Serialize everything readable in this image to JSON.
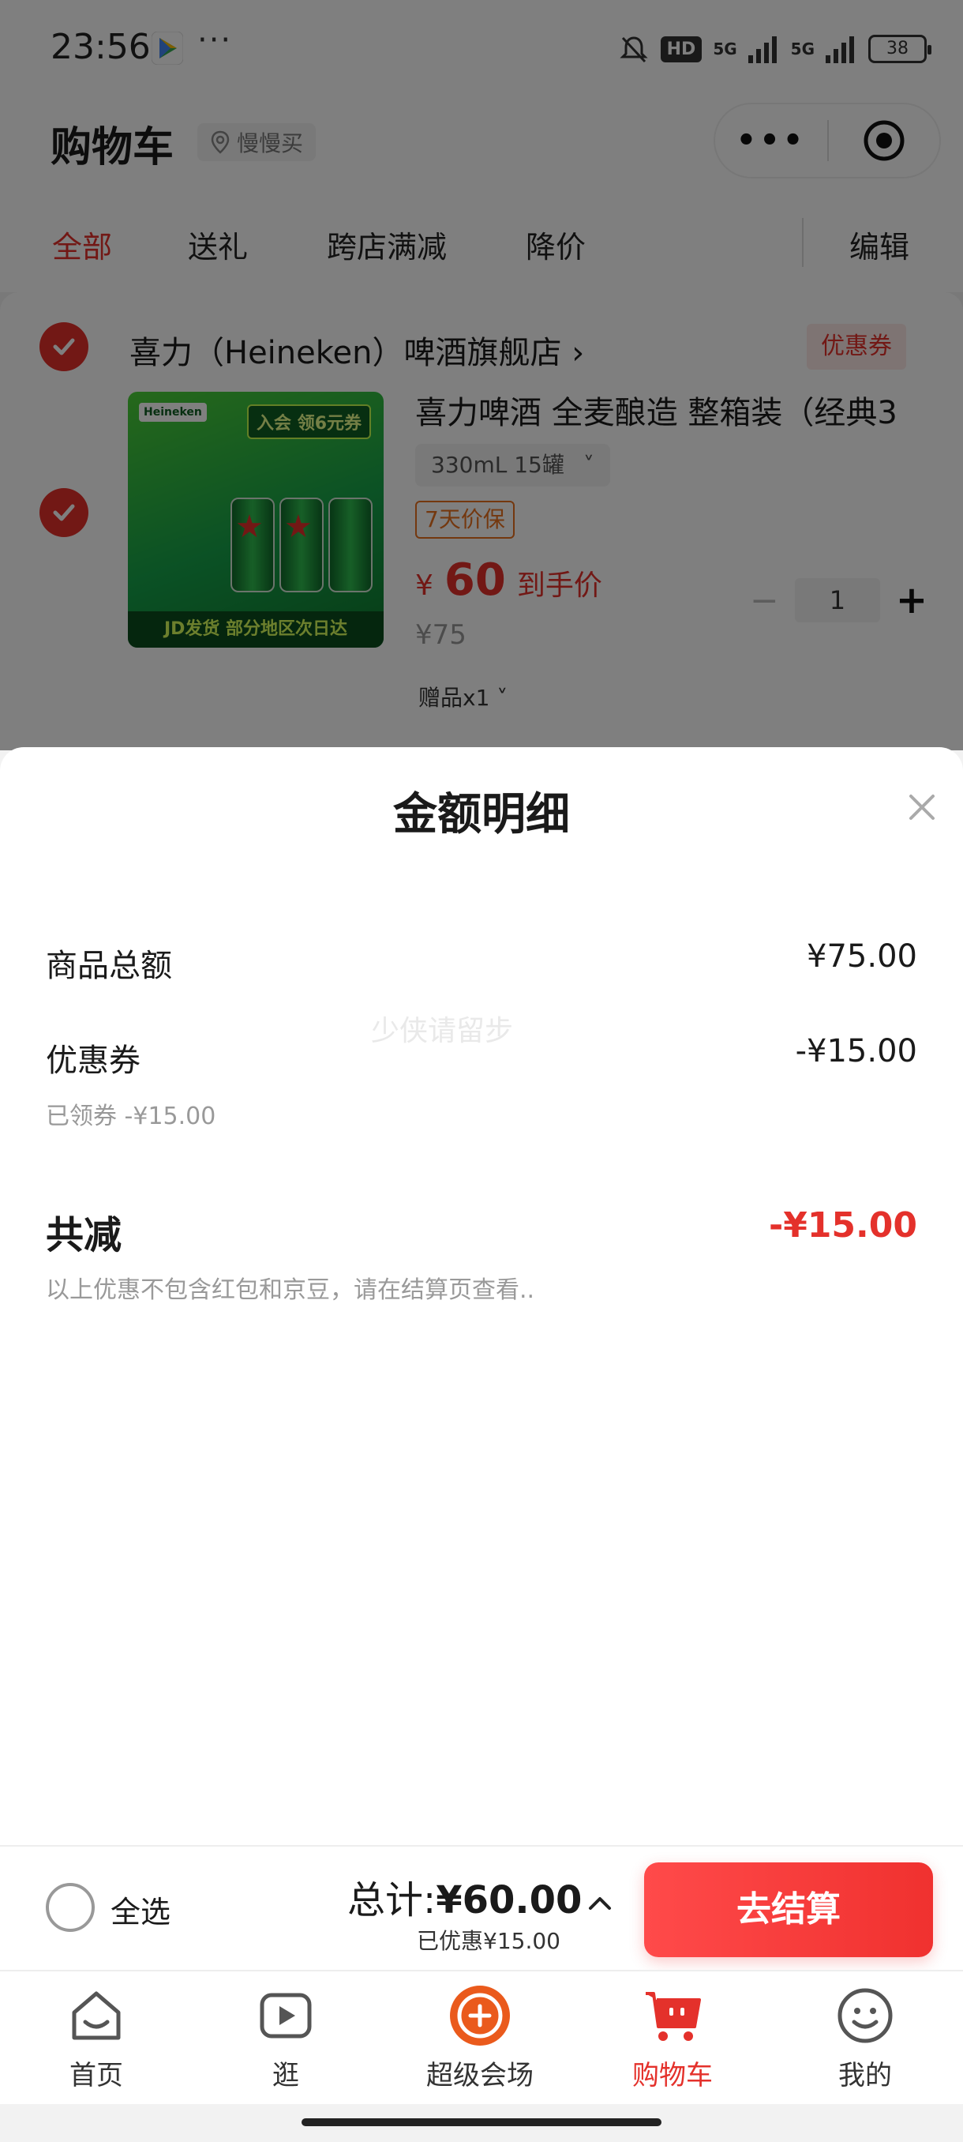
{
  "status_bar": {
    "time": "23:56",
    "dots": "···",
    "hd": "HD",
    "net1": "5G",
    "net2": "5G",
    "battery": "38"
  },
  "header": {
    "title": "购物车",
    "location": "慢慢买",
    "tabs": [
      "全部",
      "送礼",
      "跨店满减",
      "降价"
    ],
    "edit": "编辑",
    "capsule_more": "•••"
  },
  "shop": {
    "name": "喜力（Heineken）啤酒旗舰店",
    "arrow": "›",
    "coupon_tag": "优惠券"
  },
  "product": {
    "title": "喜力啤酒 全麦酿造 整箱装（经典3",
    "spec": "330mL 15罐",
    "spec_arrow": "˅",
    "guarantee": "7天价保",
    "price_currency": "¥",
    "price": "60",
    "price_label": "到手价",
    "original_price": "¥75",
    "gift": "赠品x1 ˅",
    "quantity": "1",
    "minus": "−",
    "plus": "+",
    "image_tag": "入会 领6元券",
    "image_logo": "Heineken",
    "image_banner": "JD发货 部分地区次日达"
  },
  "sheet": {
    "title": "金额明细",
    "watermark": "少侠请留步",
    "rows": [
      {
        "label": "商品总额",
        "value": "¥75.00"
      },
      {
        "label": "优惠券",
        "value": "-¥15.00",
        "sub": "已领券 -¥15.00"
      }
    ],
    "total_label": "共减",
    "total_value": "-¥15.00",
    "note": "以上优惠不包含红包和京豆，请在结算页查看.."
  },
  "checkout": {
    "select_all": "全选",
    "total_prefix": "总计:",
    "total_amount": "¥60.00",
    "saved": "已优惠¥15.00",
    "button": "去结算"
  },
  "tabbar": {
    "items": [
      "首页",
      "逛",
      "超级会场",
      "购物车",
      "我的"
    ],
    "active_index": 3
  },
  "colors": {
    "accent": "#e4312b",
    "overlay": "rgba(0,0,0,0.5)"
  }
}
